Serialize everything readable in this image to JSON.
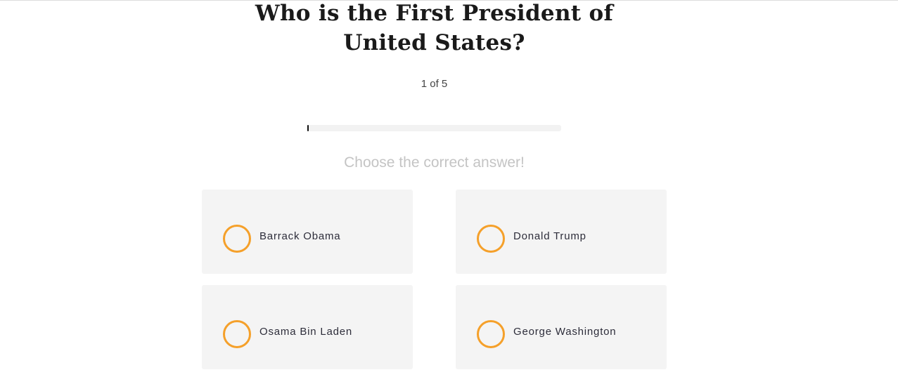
{
  "question": {
    "line1": "Who is the First President of",
    "line2": "United States?"
  },
  "progress": {
    "counter": "1 of 5",
    "fill_fraction": 0.005,
    "fill_color": "#111111",
    "track_color": "#f2f2f2"
  },
  "instruction": "Choose the correct answer!",
  "options": [
    {
      "label": "Barrack Obama"
    },
    {
      "label": "Donald Trump"
    },
    {
      "label": "Osama Bin Laden"
    },
    {
      "label": "George Washington"
    }
  ],
  "colors": {
    "radio_accent": "#f5a02a",
    "card_background": "#f4f4f4",
    "title_text": "#1a1a1a",
    "instruction_text": "#c4c4c4"
  }
}
